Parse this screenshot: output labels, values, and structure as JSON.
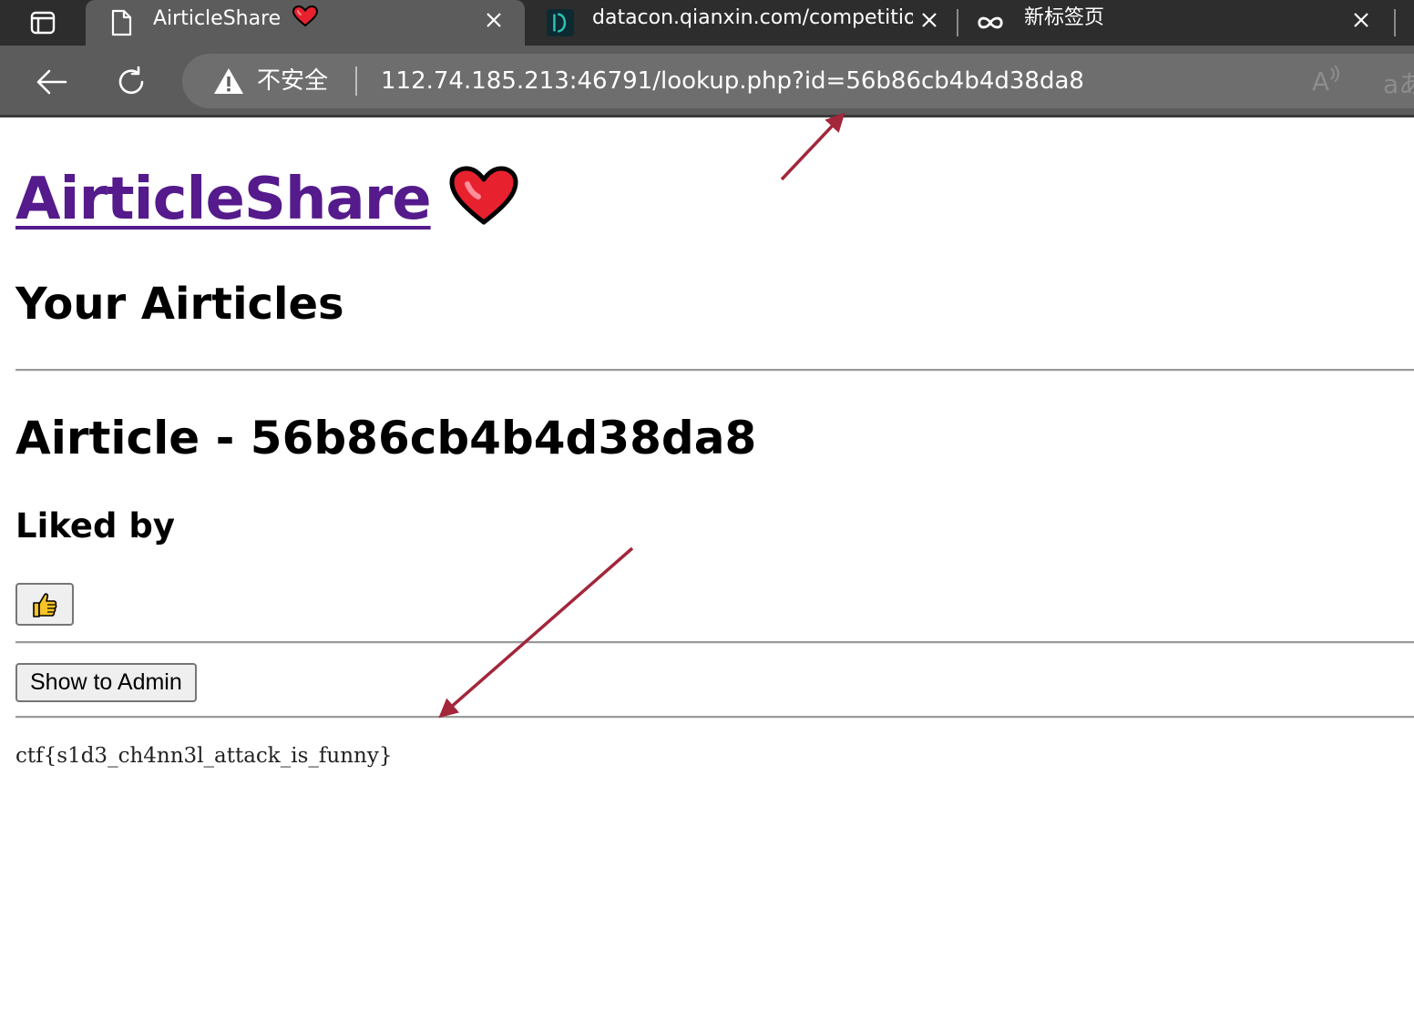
{
  "browser": {
    "tabs": [
      {
        "title": "AirticleShare",
        "favicon": "page-icon",
        "active": true
      },
      {
        "title": "datacon.qianxin.com/competitior",
        "favicon": "datacon-logo-icon",
        "active": false
      },
      {
        "title": "新标签页",
        "favicon": "infinity-icon",
        "active": false
      }
    ],
    "toolbar": {
      "security_label": "不安全",
      "url": "112.74.185.213:46791/lookup.php?id=56b86cb4b4d38da8",
      "read_aloud_glyph": "A",
      "translate_glyph": "aあ"
    }
  },
  "page": {
    "site_title": "AirticleShare",
    "heading_your": "Your Airticles",
    "article_heading": "Airticle - 56b86cb4b4d38da8",
    "liked_heading": "Liked by",
    "like_button_icon": "thumbs-up-icon",
    "admin_button_label": "Show to Admin",
    "flag_text": "ctf{s1d3_ch4nn3l_attack_is_funny}"
  },
  "colors": {
    "link_visited": "#551a8b",
    "annotation_arrow": "#a3263a",
    "tab_active": "#5c5c5c",
    "tabstrip": "#2d2d2d"
  }
}
